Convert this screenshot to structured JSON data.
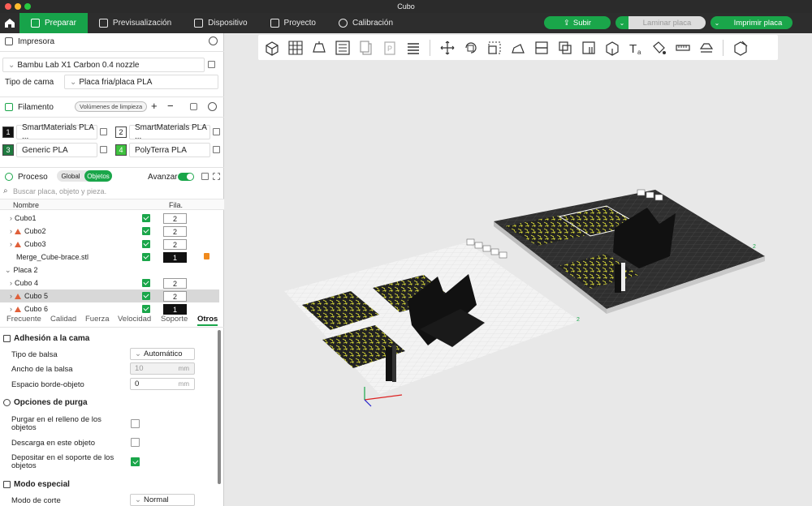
{
  "window": {
    "title": "Cubo"
  },
  "menu": {
    "tabs": [
      {
        "label": "Preparar",
        "active": true
      },
      {
        "label": "Previsualización",
        "active": false
      },
      {
        "label": "Dispositivo",
        "active": false
      },
      {
        "label": "Proyecto",
        "active": false
      },
      {
        "label": "Calibración",
        "active": false
      }
    ],
    "upload": "Subir",
    "slice": "Laminar placa",
    "print": "Imprimir placa"
  },
  "printer": {
    "section": "Impresora",
    "model": "Bambu Lab X1 Carbon 0.4 nozzle",
    "bed_label": "Tipo de cama",
    "bed_value": "Placa fria/placa PLA"
  },
  "filament": {
    "section": "Filamento",
    "flush_label": "Volúmenes de limpieza",
    "items": [
      {
        "num": "1",
        "name": "SmartMaterials PLA ...",
        "color": "#111111",
        "text": "#ffffff"
      },
      {
        "num": "2",
        "name": "SmartMaterials PLA ...",
        "color": "#ffffff",
        "text": "#111111"
      },
      {
        "num": "3",
        "name": "Generic PLA",
        "color": "#1f7a3f",
        "text": "#ffffff"
      },
      {
        "num": "4",
        "name": "PolyTerra PLA",
        "color": "#3ec13e",
        "text": "#ffffff"
      }
    ]
  },
  "process": {
    "section": "Proceso",
    "seg_global": "Global",
    "seg_objects": "Objetos",
    "advanced": "Avanzar",
    "search_placeholder": "Buscar placa, objeto y pieza.",
    "col_name": "Nombre",
    "col_fil": "Fila.",
    "rows": [
      {
        "name": "Cubo1",
        "num": "2",
        "warn": false,
        "indent": 12,
        "chev": "›",
        "check": true,
        "sel": false,
        "dark": false
      },
      {
        "name": "Cubo2",
        "num": "2",
        "warn": true,
        "indent": 12,
        "chev": "›",
        "check": true,
        "sel": false,
        "dark": false
      },
      {
        "name": "Cubo3",
        "num": "2",
        "warn": true,
        "indent": 12,
        "chev": "›",
        "check": true,
        "sel": false,
        "dark": false
      },
      {
        "name": "Merge_Cube-brace.stl",
        "num": "1",
        "warn": false,
        "indent": 20,
        "chev": "",
        "check": true,
        "sel": false,
        "dark": true,
        "lock": true
      },
      {
        "name": "Placa 2",
        "num": "",
        "warn": false,
        "indent": 6,
        "chev": "⌄",
        "check": false,
        "sel": false,
        "dark": false,
        "plate": true
      },
      {
        "name": "Cubo 4",
        "num": "2",
        "warn": false,
        "indent": 12,
        "chev": "›",
        "check": true,
        "sel": false,
        "dark": false
      },
      {
        "name": "Cubo 5",
        "num": "2",
        "warn": true,
        "indent": 12,
        "chev": "›",
        "check": true,
        "sel": true,
        "dark": false
      },
      {
        "name": "Cubo 6",
        "num": "1",
        "warn": true,
        "indent": 12,
        "chev": "›",
        "check": true,
        "sel": false,
        "dark": true
      }
    ],
    "subtabs": [
      "Frecuente",
      "Calidad",
      "Fuerza",
      "Velocidad",
      "Soporte",
      "Otros"
    ],
    "adhesion": {
      "title": "Adhesión a la cama",
      "raft_type_label": "Tipo de balsa",
      "raft_type_value": "Automático",
      "raft_width_label": "Ancho de la balsa",
      "raft_width_value": "10",
      "gap_label": "Espacio borde-objeto",
      "gap_value": "0",
      "unit": "mm"
    },
    "purge": {
      "title": "Opciones de purga",
      "infill_label": "Purgar en el relleno de los objetos",
      "object_label": "Descarga en este objeto",
      "support_label": "Depositar en el soporte de los objetos"
    },
    "special": {
      "title": "Modo especial",
      "slicing_label": "Modo de corte",
      "slicing_value": "Normal"
    }
  }
}
